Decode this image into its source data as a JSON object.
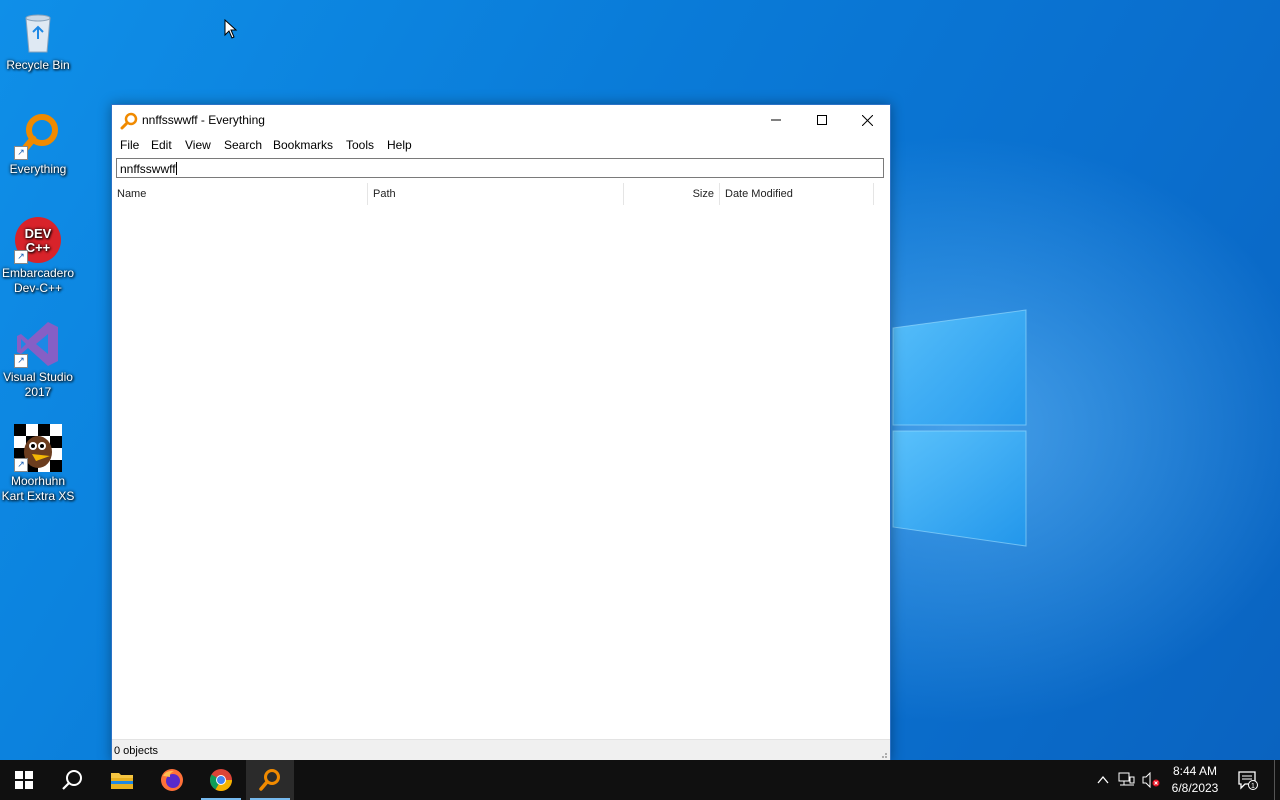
{
  "desktop": {
    "icons": [
      {
        "label": "Recycle Bin"
      },
      {
        "label": "Everything"
      },
      {
        "label": "Embarcadero Dev-C++"
      },
      {
        "label": "Visual Studio 2017"
      },
      {
        "label": "Moorhuhn Kart Extra XS"
      }
    ]
  },
  "window": {
    "title": "nnffsswwff - Everything",
    "menu": [
      "File",
      "Edit",
      "View",
      "Search",
      "Bookmarks",
      "Tools",
      "Help"
    ],
    "search_value": "nnffsswwff",
    "columns": [
      "Name",
      "Path",
      "Size",
      "Date Modified"
    ],
    "status": "0 objects"
  },
  "taskbar": {
    "apps": [
      {
        "icon": "windows-start-icon"
      },
      {
        "icon": "search-icon"
      },
      {
        "icon": "file-explorer-icon"
      },
      {
        "icon": "firefox-icon"
      },
      {
        "icon": "chrome-icon"
      },
      {
        "icon": "everything-icon",
        "active": true
      }
    ],
    "time": "8:44 AM",
    "date": "6/8/2023",
    "notification_count": "1"
  }
}
